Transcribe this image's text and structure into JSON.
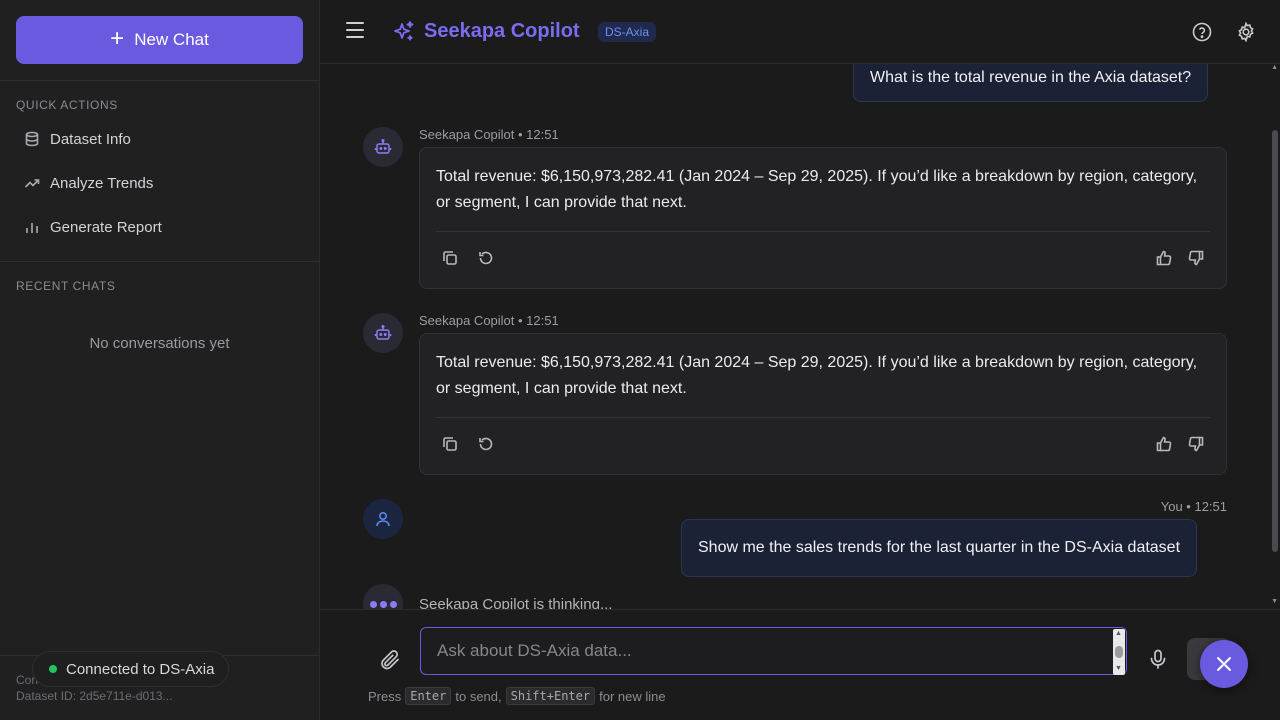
{
  "colors": {
    "accent": "#6a5ae0",
    "connected": "#22c55e",
    "badge_bg": "#1f2a4d"
  },
  "sidebar": {
    "new_chat_label": "New Chat",
    "quick_actions_title": "QUICK ACTIONS",
    "quick_actions": [
      {
        "label": "Dataset Info",
        "icon": "database-icon"
      },
      {
        "label": "Analyze Trends",
        "icon": "trending-up-icon"
      },
      {
        "label": "Generate Report",
        "icon": "bar-chart-icon"
      }
    ],
    "recent_chats_title": "RECENT CHATS",
    "recent_empty": "No conversations yet",
    "footer_label": "Con",
    "dataset_id": "Dataset ID: 2d5e711e-d013...",
    "connection_status": "Connected to DS-Axia"
  },
  "header": {
    "title": "Seekapa Copilot",
    "badge": "DS-Axia"
  },
  "messages": [
    {
      "role": "user",
      "text": "What is the total revenue in the Axia dataset?"
    },
    {
      "role": "assistant",
      "meta": "Seekapa Copilot • 12:51",
      "text": "Total revenue: $6,150,973,282.41 (Jan 2024 – Sep 29, 2025). If you’d like a breakdown by region, category, or segment, I can provide that next."
    },
    {
      "role": "assistant",
      "meta": "Seekapa Copilot • 12:51",
      "text": "Total revenue: $6,150,973,282.41 (Jan 2024 – Sep 29, 2025). If you’d like a breakdown by region, category, or segment, I can provide that next."
    },
    {
      "role": "user",
      "meta": "You • 12:51",
      "text": "Show me the sales trends for the last quarter in the DS-Axia dataset"
    }
  ],
  "thinking_text": "Seekapa Copilot is thinking...",
  "composer": {
    "placeholder": "Ask about DS-Axia data...",
    "hint_press": "Press",
    "hint_enter_key": "Enter",
    "hint_to_send": "to send,",
    "hint_shift_enter_key": "Shift+Enter",
    "hint_new_line": "for new line"
  }
}
